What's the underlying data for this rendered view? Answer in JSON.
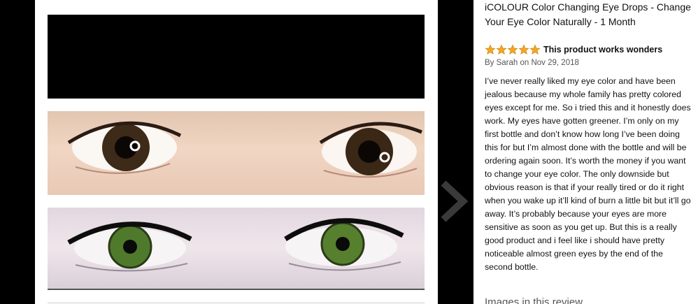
{
  "product": {
    "title": "iCOLOUR Color Changing Eye Drops - Change Your Eye Color Naturally - 1 Month"
  },
  "review": {
    "rating": 5,
    "rating_max": 5,
    "title": "This product works wonders",
    "meta": "By Sarah on Nov 29, 2018",
    "body": "I’ve never really liked my eye color and have been jealous because my whole family has pretty colored eyes except for me. So i tried this and it honestly does work. My eyes have gotten greener. I’m only on my first bottle and don’t know how long I’ve been doing this for but I’m almost done with the bottle and will be ordering again soon. It’s worth the money if you want to change your eye color. The only downside but obvious reason is that if your really tired or do it right when you wake up it’ll kind of burn a little bit but it’ll go away. It’s probably because your eyes are more sensitive as soon as you get up. But this is a really good product and i feel like i should have pretty noticeable almost green eyes by the end of the second bottle.",
    "images_heading": "Images in this review"
  },
  "colors": {
    "star": "#f5a623",
    "star_stroke": "#c98a0f",
    "arrow": "#3a3a3a"
  },
  "icons": {
    "next": "chevron-right-icon",
    "star": "star-icon"
  }
}
